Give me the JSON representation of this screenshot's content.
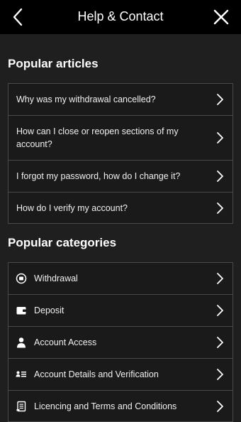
{
  "header": {
    "title": "Help & Contact"
  },
  "popular_articles": {
    "title": "Popular articles",
    "items": [
      {
        "label": "Why was my withdrawal cancelled?"
      },
      {
        "label": "How can I close or reopen sections of my account?"
      },
      {
        "label": "I forgot my password, how do I change it?"
      },
      {
        "label": "How do I verify my account?"
      }
    ]
  },
  "popular_categories": {
    "title": "Popular categories",
    "items": [
      {
        "label": "Withdrawal",
        "icon": "withdrawal-icon"
      },
      {
        "label": "Deposit",
        "icon": "wallet-icon"
      },
      {
        "label": "Account Access",
        "icon": "person-icon"
      },
      {
        "label": "Account Details and Verification",
        "icon": "account-details-icon"
      },
      {
        "label": "Licencing and Terms and Conditions",
        "icon": "document-icon"
      }
    ]
  },
  "colors": {
    "header_bg": "#000000",
    "page_bg": "#1f1f1f",
    "row_border": "#4a4a4a",
    "text": "#ffffff"
  }
}
